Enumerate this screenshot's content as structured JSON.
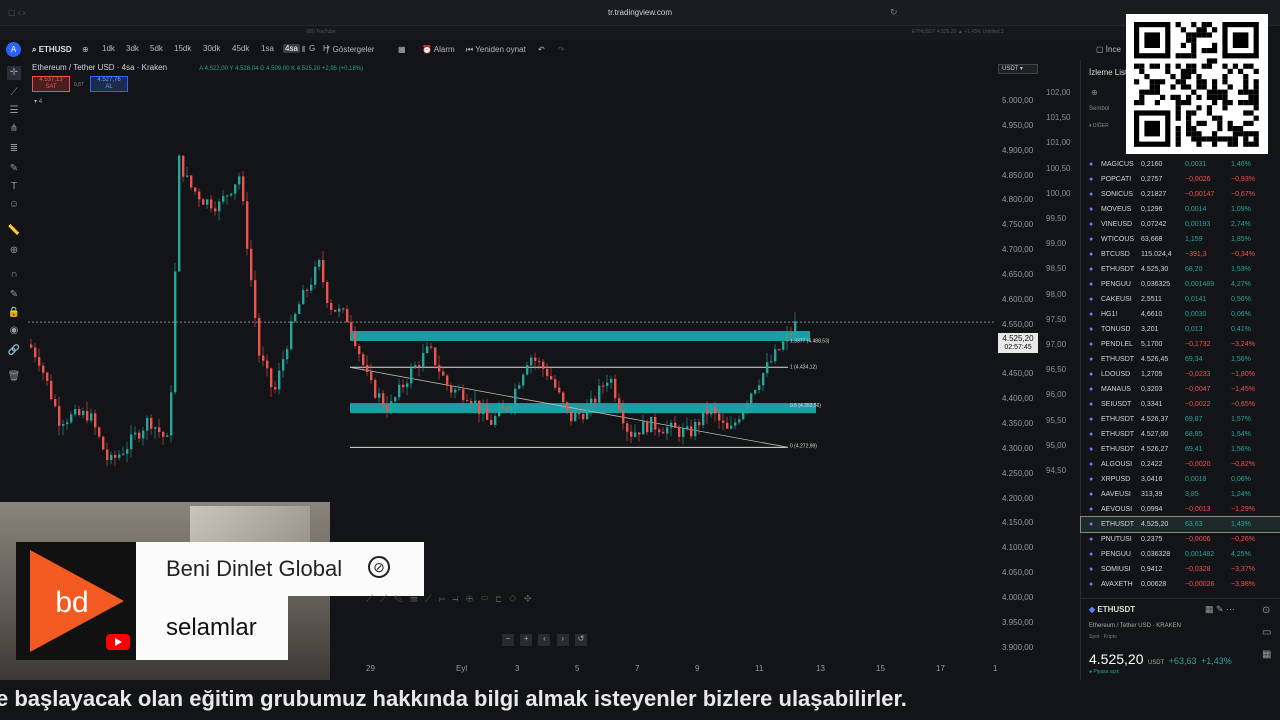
{
  "browser": {
    "url": "tr.tradingview.com",
    "tab_title": "ETHUSDT 4.525,20 ▲ +1,43% Untitled 3",
    "tab_left": "(80) YouTube"
  },
  "toolbar": {
    "symbol": "ETHUSD",
    "intervals": [
      "1dk",
      "3dk",
      "5dk",
      "15dk",
      "30dk",
      "45dk",
      "1sa",
      "4sa",
      "G",
      "H"
    ],
    "active_interval": "4sa",
    "indicators_label": "Göstergeler",
    "alert_label": "Alarm",
    "replay_label": "Yeniden oynat",
    "right_label": "İnce"
  },
  "legend": {
    "title": "Ethereum / Tether USD · 4sa · Kraken",
    "ohlc": "A 4.522,00  Y 4.528,04  D 4.509,00  K 4.525,20  +2,95 (+0,18%)",
    "sell_price": "4.537,13",
    "sell_label": "SAT",
    "spread": "0,87",
    "buy_price": "4.527,76",
    "buy_label": "AL",
    "indicator_count": "4",
    "currency": "USDT"
  },
  "price_axis": [
    "5.000,00",
    "4.950,00",
    "4.900,00",
    "4.850,00",
    "4.800,00",
    "4.750,00",
    "4.700,00",
    "4.650,00",
    "4.600,00",
    "4.550,00",
    "4.500,00",
    "4.450,00",
    "4.400,00",
    "4.350,00",
    "4.300,00",
    "4.250,00",
    "4.200,00",
    "4.150,00",
    "4.100,00",
    "4.050,00",
    "4.000,00",
    "3.950,00",
    "3.900,00"
  ],
  "pct_axis": [
    "102,00",
    "101,50",
    "101,00",
    "100,50",
    "100,00",
    "99,50",
    "99,00",
    "98,50",
    "98,00",
    "97,50",
    "97,00",
    "96,50",
    "96,00",
    "95,50",
    "95,00",
    "94,50"
  ],
  "current_price": {
    "value": "4.525,20",
    "countdown": "02:57:45"
  },
  "fib_labels": [
    "1.3377 (4.488,53)",
    "1 (4.434,12)",
    "0.5 (4.353,56)",
    "0 (4.272,99)"
  ],
  "time_axis": [
    "29",
    "Eyl",
    "3",
    "5",
    "7",
    "9",
    "11",
    "13",
    "15",
    "17",
    "1"
  ],
  "watchlist": {
    "title": "İzleme Listesi",
    "column_symbol": "Sembol",
    "group": "DİĞER",
    "rows": [
      {
        "sym": "MAGICUS",
        "last": "0,2160",
        "chg": "0,0031",
        "pct": "1,46%",
        "dir": "up"
      },
      {
        "sym": "POPCATI",
        "last": "0,2757",
        "chg": "−0,0026",
        "pct": "−0,93%",
        "dir": "down"
      },
      {
        "sym": "SONICUS",
        "last": "0,21827",
        "chg": "−0,00147",
        "pct": "−0,67%",
        "dir": "down"
      },
      {
        "sym": "MOVEUS",
        "last": "0,1296",
        "chg": "0,0014",
        "pct": "1,09%",
        "dir": "up"
      },
      {
        "sym": "VINEUSD",
        "last": "0,07242",
        "chg": "0,00193",
        "pct": "2,74%",
        "dir": "up"
      },
      {
        "sym": "WTICOUS",
        "last": "63,668",
        "chg": "1,159",
        "pct": "1,85%",
        "dir": "up"
      },
      {
        "sym": "BTCUSD",
        "last": "115.024,4",
        "chg": "−391,3",
        "pct": "−0,34%",
        "dir": "down"
      },
      {
        "sym": "ETHUSDT",
        "last": "4.525,30",
        "chg": "68,20",
        "pct": "1,53%",
        "dir": "up"
      },
      {
        "sym": "PENGUU",
        "last": "0,036325",
        "chg": "0,001489",
        "pct": "4,27%",
        "dir": "up"
      },
      {
        "sym": "CAKEUSI",
        "last": "2,5511",
        "chg": "0,0141",
        "pct": "0,56%",
        "dir": "up"
      },
      {
        "sym": "HG1!",
        "last": "4,6610",
        "chg": "0,0030",
        "pct": "0,06%",
        "dir": "up"
      },
      {
        "sym": "TONUSD",
        "last": "3,201",
        "chg": "0,013",
        "pct": "0,41%",
        "dir": "up"
      },
      {
        "sym": "PENDLEL",
        "last": "5,1700",
        "chg": "−0,1732",
        "pct": "−3,24%",
        "dir": "down"
      },
      {
        "sym": "ETHUSDT",
        "last": "4.526,45",
        "chg": "69,34",
        "pct": "1,56%",
        "dir": "up"
      },
      {
        "sym": "LDOUSD",
        "last": "1,2705",
        "chg": "−0,0233",
        "pct": "−1,80%",
        "dir": "down"
      },
      {
        "sym": "MANAUS",
        "last": "0,3203",
        "chg": "−0,0047",
        "pct": "−1,45%",
        "dir": "down"
      },
      {
        "sym": "SEIUSDT",
        "last": "0,3341",
        "chg": "−0,0022",
        "pct": "−0,65%",
        "dir": "down"
      },
      {
        "sym": "ETHUSDT",
        "last": "4.526,37",
        "chg": "69,87",
        "pct": "1,57%",
        "dir": "up"
      },
      {
        "sym": "ETHUSDT",
        "last": "4.527,00",
        "chg": "68,85",
        "pct": "1,54%",
        "dir": "up"
      },
      {
        "sym": "ETHUSDT",
        "last": "4.526,27",
        "chg": "69,41",
        "pct": "1,56%",
        "dir": "up"
      },
      {
        "sym": "ALGOUSI",
        "last": "0,2422",
        "chg": "−0,0020",
        "pct": "−0,82%",
        "dir": "down"
      },
      {
        "sym": "XRPUSD",
        "last": "3,0416",
        "chg": "0,0018",
        "pct": "0,06%",
        "dir": "up"
      },
      {
        "sym": "AAVEUSI",
        "last": "313,39",
        "chg": "3,85",
        "pct": "1,24%",
        "dir": "up"
      },
      {
        "sym": "AEVOUSI",
        "last": "0,0994",
        "chg": "−0,0013",
        "pct": "−1,29%",
        "dir": "down"
      },
      {
        "sym": "ETHUSDT",
        "last": "4.525,20",
        "chg": "63,63",
        "pct": "1,43%",
        "dir": "up",
        "selected": true
      },
      {
        "sym": "PNUTUSI",
        "last": "0,2375",
        "chg": "−0,0006",
        "pct": "−0,26%",
        "dir": "down"
      },
      {
        "sym": "PENGUU",
        "last": "0,036328",
        "chg": "0,001482",
        "pct": "4,25%",
        "dir": "up"
      },
      {
        "sym": "SOMIUSI",
        "last": "0,9412",
        "chg": "−0,0328",
        "pct": "−3,37%",
        "dir": "down"
      },
      {
        "sym": "AVAXETH",
        "last": "0,00628",
        "chg": "−0,00026",
        "pct": "−3,98%",
        "dir": "down"
      }
    ]
  },
  "detail": {
    "symbol": "ETHUSDT",
    "name": "Ethereum / Tether USD",
    "exchange": "KRAKEN",
    "sub": "Spot · Kripto",
    "price": "4.525,20",
    "currency": "USDT",
    "change": "+63,63",
    "change_pct": "+1,43%",
    "status": "Piyasa açık"
  },
  "overlay": {
    "channel": "Beni Dinlet Global",
    "message": "selamlar",
    "logo_text": "bd"
  },
  "ticker": "e başlayacak olan eğitim grubumuz hakkında bilgi almak isteyenler bizlere ulaşabilirler.",
  "colors": {
    "up": "#26a69a",
    "down": "#ef5350",
    "zone": "#1fb5bf",
    "bg": "#131418",
    "brand_orange": "#f25a22"
  }
}
